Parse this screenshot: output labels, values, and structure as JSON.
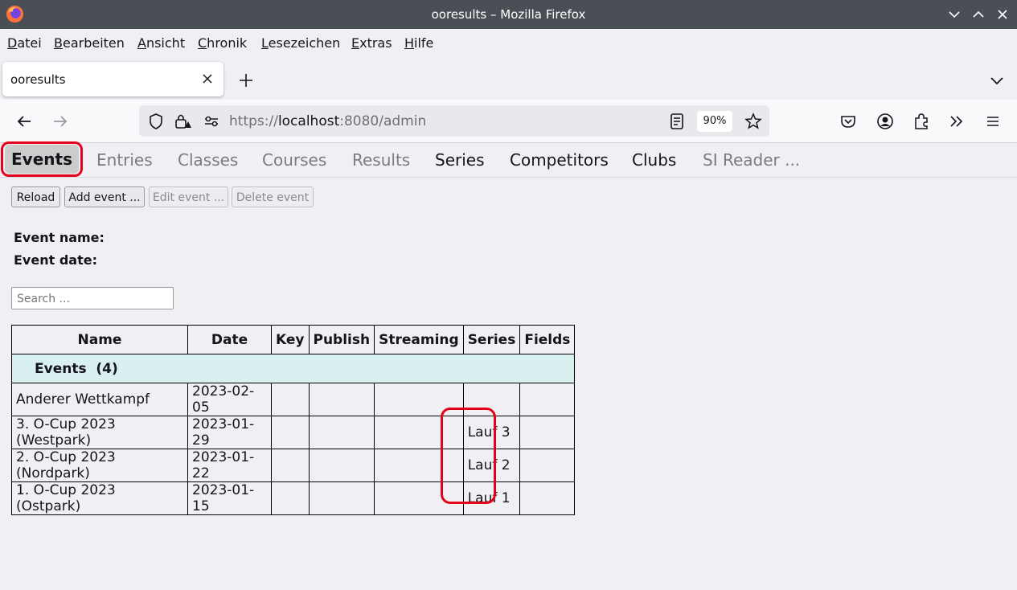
{
  "window": {
    "title": "ooresults – Mozilla Firefox"
  },
  "menu": {
    "items": [
      "Datei",
      "Bearbeiten",
      "Ansicht",
      "Chronik",
      "Lesezeichen",
      "Extras",
      "Hilfe"
    ]
  },
  "browser_tab": {
    "label": "ooresults"
  },
  "address": {
    "scheme": "https://",
    "host": "localhost",
    "rest": ":8080/admin",
    "zoom": "90%"
  },
  "app": {
    "tabs": [
      "Events",
      "Entries",
      "Classes",
      "Courses",
      "Results",
      "Series",
      "Competitors",
      "Clubs",
      "SI Reader ..."
    ],
    "buttons": {
      "reload": "Reload",
      "add": "Add event ...",
      "edit": "Edit event ...",
      "delete": "Delete event"
    },
    "event_name_label": "Event name:",
    "event_date_label": "Event date:",
    "search_placeholder": "Search ...",
    "table": {
      "headers": [
        "Name",
        "Date",
        "Key",
        "Publish",
        "Streaming",
        "Series",
        "Fields"
      ],
      "group": "Events  (4)",
      "rows": [
        {
          "name": "Anderer Wettkampf",
          "date": "2023-02-05",
          "key": "",
          "publish": "",
          "streaming": "",
          "series": "",
          "fields": ""
        },
        {
          "name": "3. O-Cup 2023 (Westpark)",
          "date": "2023-01-29",
          "key": "",
          "publish": "",
          "streaming": "",
          "series": "Lauf 3",
          "fields": ""
        },
        {
          "name": "2. O-Cup 2023 (Nordpark)",
          "date": "2023-01-22",
          "key": "",
          "publish": "",
          "streaming": "",
          "series": "Lauf 2",
          "fields": ""
        },
        {
          "name": "1. O-Cup 2023 (Ostpark)",
          "date": "2023-01-15",
          "key": "",
          "publish": "",
          "streaming": "",
          "series": "Lauf 1",
          "fields": ""
        }
      ]
    }
  },
  "colors": {
    "highlight": "#e3001b",
    "group_row": "#d9f0f0",
    "titlebar": "#4a4f56"
  }
}
